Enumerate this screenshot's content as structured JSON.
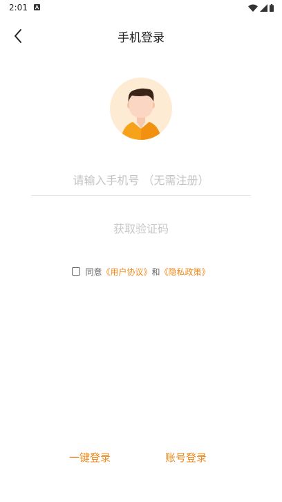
{
  "status_bar": {
    "time": "2:01",
    "icons": [
      "app-notification-icon",
      "wifi-icon",
      "signal-icon",
      "battery-icon"
    ]
  },
  "nav": {
    "back_icon": "chevron-left-icon",
    "title": "手机登录"
  },
  "avatar": {
    "icon": "default-user-avatar",
    "bg_color": "#fdebd3",
    "shirt_color": "#f7a21b"
  },
  "phone_field": {
    "placeholder": "请输入手机号 （无需注册）",
    "value": ""
  },
  "get_code_label": "获取验证码",
  "agreement": {
    "checked": false,
    "prefix": "同意",
    "user_agreement": "《用户协议》",
    "conjunction": "和",
    "privacy_policy": "《隐私政策》"
  },
  "bottom": {
    "one_click_login": "一键登录",
    "account_login": "账号登录"
  },
  "colors": {
    "accent": "#f08a1e",
    "placeholder": "#c4c4c4",
    "text": "#222222"
  }
}
